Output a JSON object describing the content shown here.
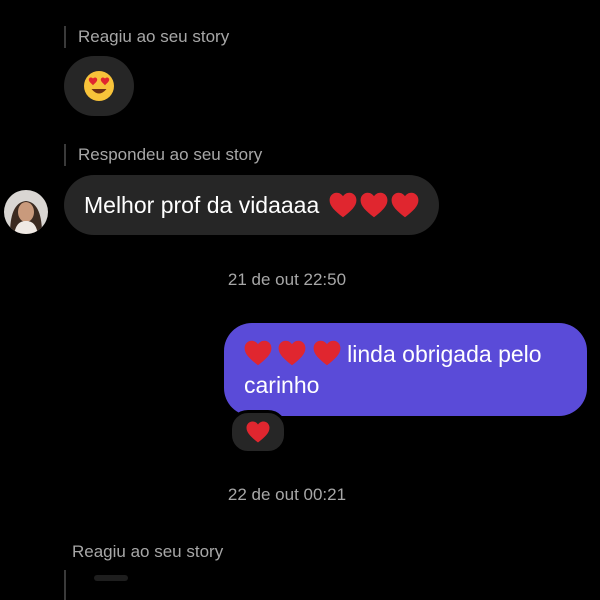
{
  "thread": {
    "reply_context_1": "Reagiu ao seu story",
    "reaction_emoji_name": "heart-eyes-emoji",
    "reply_context_2": "Respondeu ao seu story",
    "incoming_message": "Melhor prof da vidaaaa",
    "timestamp_1": "21 de out 22:50",
    "outgoing_message_line1": "linda obrigada pelo",
    "outgoing_message_line2": "carinho",
    "timestamp_2": "22 de out 00:21",
    "reply_context_3": "Reagiu ao seu story"
  },
  "colors": {
    "background": "#000000",
    "incoming_bubble": "#262626",
    "outgoing_bubble": "#5a4bd8",
    "secondary_text": "#a7a7a7",
    "heart": "#e0262f"
  }
}
